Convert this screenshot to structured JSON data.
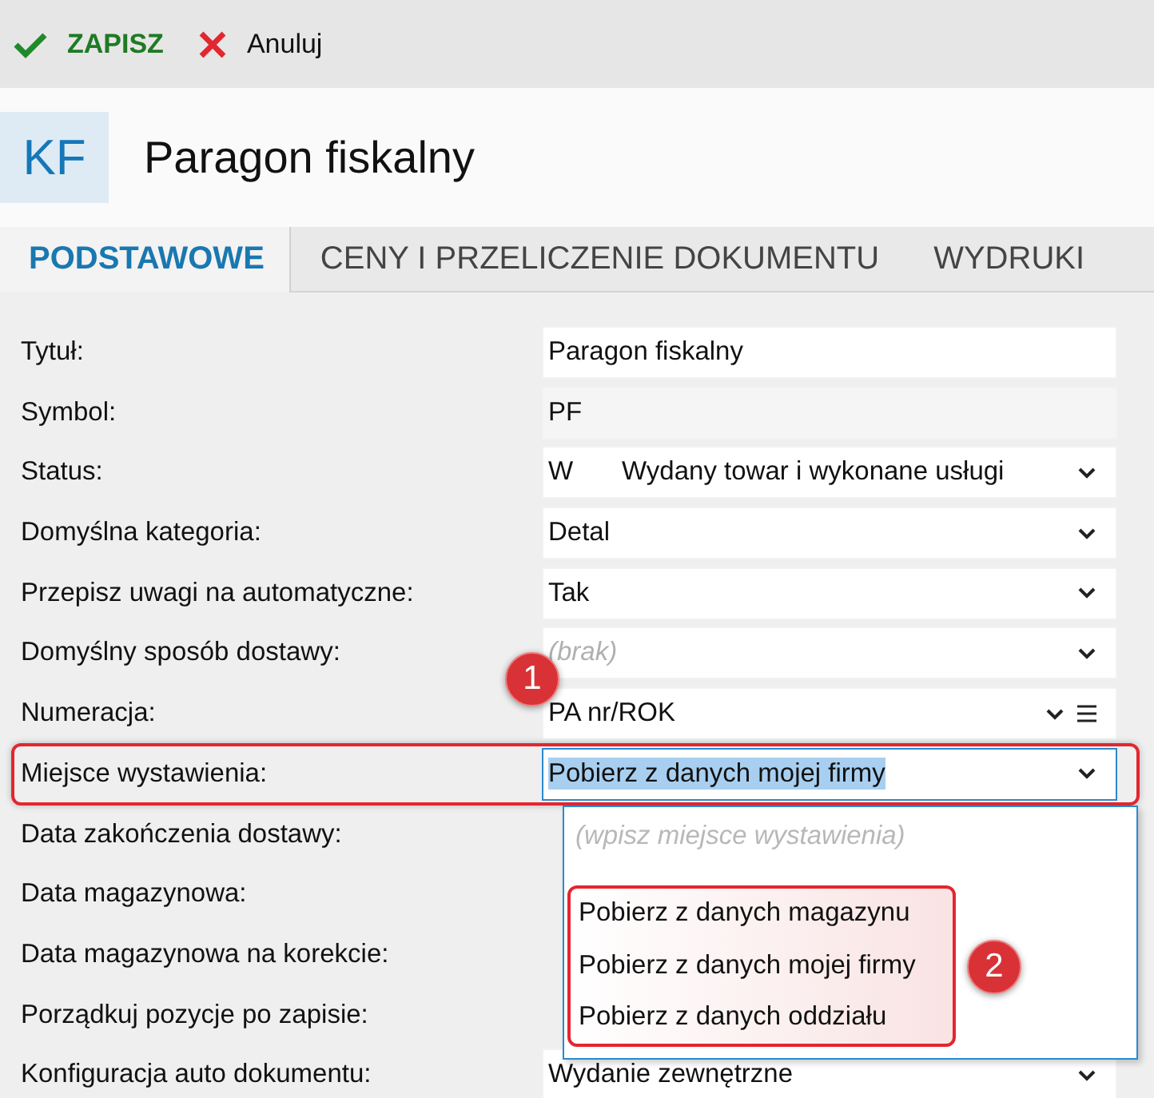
{
  "toolbar": {
    "buttons": [
      {
        "kind": "save",
        "label": "ZAPISZ"
      },
      {
        "kind": "cancel",
        "label": "Anuluj"
      }
    ]
  },
  "header": {
    "badge": "KF",
    "title": "Paragon fiskalny"
  },
  "tabs": [
    {
      "label": "PODSTAWOWE",
      "selected": true
    },
    {
      "label": "CENY I PRZELICZENIE DOKUMENTU",
      "selected": false
    },
    {
      "label": "WYDRUKI",
      "selected": false
    }
  ],
  "fields": [
    {
      "label": "Tytuł:",
      "kind": "text",
      "value": "Paragon fiskalny"
    },
    {
      "label": "Symbol:",
      "kind": "readonly",
      "value": "PF"
    },
    {
      "label": "Status:",
      "kind": "select",
      "code": "W",
      "value": "Wydany towar i wykonane usługi"
    },
    {
      "label": "Domyślna kategoria:",
      "kind": "select",
      "value": "Detal"
    },
    {
      "label": "Przepisz uwagi na automatyczne:",
      "kind": "select",
      "value": "Tak"
    },
    {
      "label": "Domyślny sposób dostawy:",
      "kind": "select",
      "placeholder": "(brak)"
    },
    {
      "label": "Numeracja:",
      "kind": "select-menu",
      "value": "PA nr/ROK"
    },
    {
      "label": "Miejsce wystawienia:",
      "kind": "select",
      "value": "Pobierz z danych mojej firmy",
      "highlighted": true,
      "text_selected": true,
      "callout": "1"
    },
    {
      "label": "Data zakończenia dostawy:",
      "kind": "covered"
    },
    {
      "label": "Data magazynowa:",
      "kind": "covered"
    },
    {
      "label": "Data magazynowa na korekcie:",
      "kind": "covered"
    },
    {
      "label": "Porządkuj pozycje po zapisie:",
      "kind": "covered"
    },
    {
      "label": "Konfiguracja auto dokumentu:",
      "kind": "select",
      "value": "Wydanie zewnętrzne"
    }
  ],
  "dropdown": {
    "placeholder": "(wpisz miejsce wystawienia)",
    "callout": "2",
    "options": [
      {
        "label": "Pobierz z danych magazynu"
      },
      {
        "label": "Pobierz z danych mojej firmy"
      },
      {
        "label": "Pobierz z danych oddziału"
      }
    ]
  }
}
